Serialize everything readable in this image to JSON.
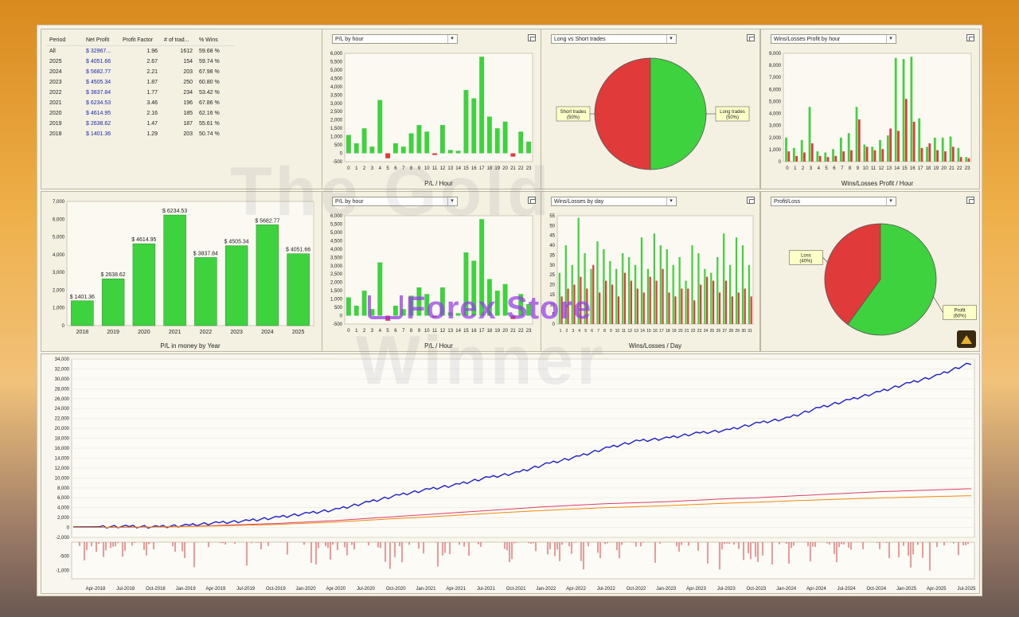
{
  "table": {
    "headers": [
      "Period",
      "Net Profit",
      "Profit Factor",
      "# of trad...",
      "% Wins"
    ],
    "rows": [
      [
        "All",
        "$ 32967...",
        "1.96",
        "1612",
        "59.68 %"
      ],
      [
        "2025",
        "$ 4051.66",
        "2.67",
        "154",
        "59.74 %"
      ],
      [
        "2024",
        "$ 5682.77",
        "2.21",
        "203",
        "67.98 %"
      ],
      [
        "2023",
        "$ 4505.34",
        "1.87",
        "250",
        "60.80 %"
      ],
      [
        "2022",
        "$ 3837.84",
        "1.77",
        "234",
        "53.42 %"
      ],
      [
        "2021",
        "$ 6234.53",
        "3.46",
        "196",
        "67.86 %"
      ],
      [
        "2020",
        "$ 4614.95",
        "2.16",
        "185",
        "62.16 %"
      ],
      [
        "2019",
        "$ 2638.62",
        "1.47",
        "187",
        "55.61 %"
      ],
      [
        "2018",
        "$ 1401.36",
        "1.29",
        "203",
        "50.74 %"
      ]
    ]
  },
  "panels": {
    "pl_hour_top": {
      "select": "P/L by hour"
    },
    "long_short": {
      "select": "Long vs Short trades"
    },
    "wl_hour": {
      "select": "Wins/Losses Profit by hour"
    },
    "pl_hour_bottom": {
      "select": "P/L by hour"
    },
    "wl_day": {
      "select": "Wins/Losses by day"
    },
    "profit_loss": {
      "select": "Profit/Loss"
    }
  },
  "watermark": {
    "line1": "The Gold",
    "line2": "Winner",
    "store": "Forex Store"
  },
  "colors": {
    "green": "#3fd23f",
    "red": "#e03a3a",
    "blue": "#1f1fc8",
    "pink": "#d8406a",
    "orange": "#f08a10"
  },
  "chart_data": [
    {
      "id": "pl_hour",
      "type": "bar",
      "xlabel": "P/L / Hour",
      "categories": [
        "0",
        "1",
        "2",
        "3",
        "4",
        "5",
        "6",
        "7",
        "8",
        "9",
        "10",
        "11",
        "12",
        "13",
        "14",
        "15",
        "16",
        "17",
        "18",
        "19",
        "20",
        "21",
        "22",
        "23"
      ],
      "values": [
        1100,
        600,
        1500,
        400,
        3200,
        -300,
        600,
        400,
        1200,
        1700,
        1300,
        -100,
        1700,
        200,
        150,
        3800,
        3300,
        5800,
        2200,
        1500,
        1900,
        -200,
        1300,
        700
      ],
      "ylim": [
        -500,
        6000
      ],
      "yticks": [
        "6,000",
        "5,500",
        "5,000",
        "4,500",
        "4,000",
        "3,500",
        "3,000",
        "2,500",
        "2,000",
        "1,500",
        "1,000",
        "500",
        "0",
        "-500"
      ]
    },
    {
      "id": "long_short",
      "type": "pie",
      "labels": [
        "Short trades (50%)",
        "Long trades (50%)"
      ],
      "values": [
        50,
        50
      ]
    },
    {
      "id": "wl_hour",
      "type": "bar",
      "xlabel": "Wins/Losses Profit / Hour",
      "categories": [
        "0",
        "1",
        "2",
        "3",
        "4",
        "5",
        "6",
        "7",
        "8",
        "9",
        "10",
        "11",
        "12",
        "13",
        "14",
        "15",
        "16",
        "17",
        "18",
        "19",
        "20",
        "21",
        "22",
        "23"
      ],
      "series": [
        {
          "name": "Wins",
          "values": [
            2100,
            1200,
            1900,
            4800,
            900,
            800,
            1100,
            2100,
            2500,
            4800,
            1500,
            1300,
            1900,
            2300,
            9100,
            9000,
            9200,
            3800,
            1300,
            2100,
            2100,
            2200,
            1200,
            400
          ]
        },
        {
          "name": "Losses",
          "values": [
            900,
            500,
            800,
            1600,
            500,
            400,
            500,
            900,
            1000,
            3700,
            1300,
            1000,
            1100,
            2900,
            2700,
            5500,
            3500,
            1200,
            1600,
            1000,
            900,
            1300,
            400,
            300
          ]
        }
      ],
      "ylim": [
        0,
        9500
      ],
      "yticks": [
        "9,000",
        "8,000",
        "7,000",
        "6,000",
        "5,000",
        "4,000",
        "3,000",
        "2,000",
        "1,000",
        "0"
      ]
    },
    {
      "id": "pl_year",
      "type": "bar",
      "xlabel": "P/L in money by Year",
      "categories": [
        "2018",
        "2019",
        "2020",
        "2021",
        "2022",
        "2023",
        "2024",
        "2025"
      ],
      "values": [
        1401.36,
        2638.62,
        4614.95,
        6234.53,
        3837.84,
        4505.34,
        5682.77,
        4051.66
      ],
      "labels": [
        "$ 1401.36",
        "$ 2638.62",
        "$ 4614.95",
        "$ 6234.53",
        "$ 3837.84",
        "$ 4505.34",
        "$ 5682.77",
        "$ 4051.66"
      ],
      "ylim": [
        0,
        7000
      ],
      "yticks": [
        "7,000",
        "6,000",
        "5,000",
        "4,000",
        "3,000",
        "2,000",
        "1,000",
        "0"
      ]
    },
    {
      "id": "wl_day",
      "type": "bar",
      "xlabel": "Wins/Losses / Day",
      "categories": [
        "1",
        "2",
        "3",
        "4",
        "5",
        "6",
        "7",
        "8",
        "9",
        "10",
        "11",
        "12",
        "13",
        "14",
        "15",
        "16",
        "17",
        "18",
        "19",
        "20",
        "21",
        "22",
        "23",
        "24",
        "25",
        "26",
        "27",
        "28",
        "29",
        "30",
        "31"
      ],
      "series": [
        {
          "name": "Wins",
          "values": [
            26,
            40,
            30,
            54,
            36,
            28,
            42,
            38,
            32,
            28,
            36,
            34,
            30,
            44,
            28,
            46,
            40,
            38,
            30,
            34,
            22,
            40,
            36,
            28,
            26,
            34,
            46,
            30,
            44,
            40,
            30
          ]
        },
        {
          "name": "Losses",
          "values": [
            14,
            18,
            20,
            24,
            18,
            30,
            16,
            22,
            20,
            14,
            26,
            22,
            18,
            16,
            24,
            22,
            28,
            16,
            14,
            18,
            18,
            12,
            20,
            24,
            22,
            16,
            22,
            14,
            16,
            18,
            14
          ]
        }
      ],
      "ylim": [
        0,
        55
      ],
      "yticks": [
        "55",
        "50",
        "45",
        "40",
        "35",
        "30",
        "25",
        "20",
        "15",
        "10",
        "5",
        "0"
      ]
    },
    {
      "id": "profit_loss",
      "type": "pie",
      "labels": [
        "Loss (40%)",
        "Profit (60%)"
      ],
      "values": [
        40,
        60
      ]
    },
    {
      "id": "equity",
      "type": "line",
      "x": [
        "Apr-2018",
        "Jul-2018",
        "Oct-2018",
        "Jan-2019",
        "Apr-2019",
        "Jul-2019",
        "Oct-2019",
        "Jan-2020",
        "Apr-2020",
        "Jul-2020",
        "Oct-2020",
        "Jan-2021",
        "Apr-2021",
        "Jul-2021",
        "Oct-2021",
        "Jan-2022",
        "Apr-2022",
        "Jul-2022",
        "Oct-2022",
        "Jan-2023",
        "Apr-2023",
        "Jul-2023",
        "Oct-2023",
        "Jan-2024",
        "Apr-2024",
        "Jul-2024",
        "Oct-2024",
        "Jan-2025",
        "Apr-2025",
        "Jul-2025"
      ],
      "series": [
        {
          "values": [
            100,
            200,
            100,
            400,
            900,
            1300,
            2000,
            2800,
            3600,
            5000,
            6400,
            7600,
            8600,
            10000,
            11000,
            12800,
            14200,
            16000,
            17400,
            18000,
            19000,
            19600,
            21000,
            22000,
            24000,
            25600,
            27200,
            29000,
            30600,
            32900
          ]
        },
        {
          "values": [
            0,
            50,
            100,
            200,
            400,
            600,
            800,
            1100,
            1400,
            1800,
            2200,
            2600,
            3000,
            3400,
            3800,
            4200,
            4500,
            4800,
            5000,
            5200,
            5500,
            5800,
            6000,
            6300,
            6600,
            6900,
            7200,
            7400,
            7600,
            7800
          ]
        },
        {
          "values": [
            0,
            40,
            80,
            150,
            300,
            450,
            600,
            850,
            1100,
            1450,
            1800,
            2100,
            2450,
            2800,
            3150,
            3450,
            3750,
            4000,
            4200,
            4400,
            4650,
            4900,
            5100,
            5350,
            5550,
            5750,
            5950,
            6100,
            6250,
            6400
          ]
        }
      ],
      "ylim": [
        -2000,
        34000
      ],
      "yticks": [
        "34,000",
        "32,000",
        "30,000",
        "28,000",
        "26,000",
        "24,000",
        "22,000",
        "20,000",
        "18,000",
        "16,000",
        "14,000",
        "12,000",
        "10,000",
        "8,000",
        "6,000",
        "4,000",
        "2,000",
        "0",
        "-2,000"
      ]
    },
    {
      "id": "drawdown",
      "type": "bar",
      "yticks": [
        "-500",
        "-1,000"
      ],
      "ylim": [
        -1300,
        0
      ]
    }
  ]
}
